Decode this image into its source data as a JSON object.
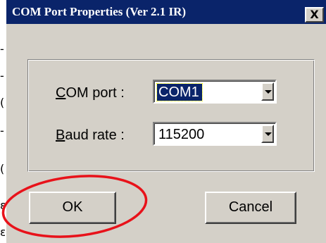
{
  "dialog": {
    "title": "COM Port Properties (Ver 2.1 IR)",
    "close_glyph": "X"
  },
  "fields": {
    "com_port": {
      "label_first": "C",
      "label_rest": "OM port :",
      "value": "COM1"
    },
    "baud_rate": {
      "label_first": "B",
      "label_rest": "aud rate :",
      "value": "115200"
    }
  },
  "buttons": {
    "ok_label": "OK",
    "cancel_label": "Cancel"
  },
  "annotation": {
    "color": "#e8121a",
    "target": "ok-button"
  },
  "colors": {
    "titlebar": "#0a246a",
    "face": "#d4d0c8"
  }
}
